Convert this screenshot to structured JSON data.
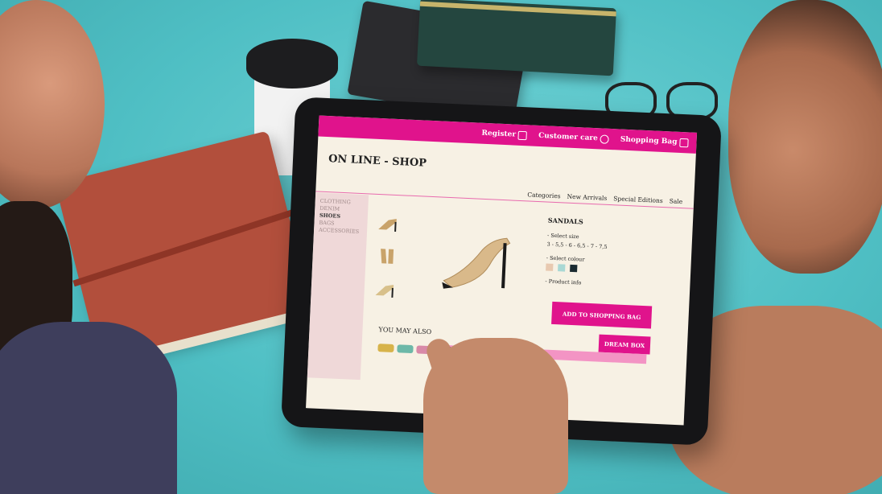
{
  "photo": {
    "scene": "people using a tablet on a turquoise table"
  },
  "tablet_ui": {
    "topbar": {
      "register": "Register",
      "customer_care": "Customer care",
      "shopping_bag": "Shopping Bag"
    },
    "shop_title": "ON LINE - SHOP",
    "nav": [
      "Categories",
      "New Arrivals",
      "Special Editions",
      "Sale"
    ],
    "sidebar": [
      "CLOTHING",
      "DENIM",
      "SHOES",
      "BAGS",
      "ACCESSORIES"
    ],
    "sidebar_selected_index": 2,
    "product": {
      "name": "SANDALS",
      "select_size_label": "- Select size",
      "sizes": "3 - 5,5 - 6 - 6,5 - 7 - 7,5",
      "select_colour_label": "- Select colour",
      "colours": [
        "#e8c9b0",
        "#a9d8d4",
        "#1a2a30"
      ],
      "product_info_label": "- Product info"
    },
    "add_button": "ADD TO SHOPPING BAG",
    "dream_button": "DREAM BOX",
    "also_like": "YOU  MAY ALSO",
    "accent_color": "#e0138c"
  }
}
